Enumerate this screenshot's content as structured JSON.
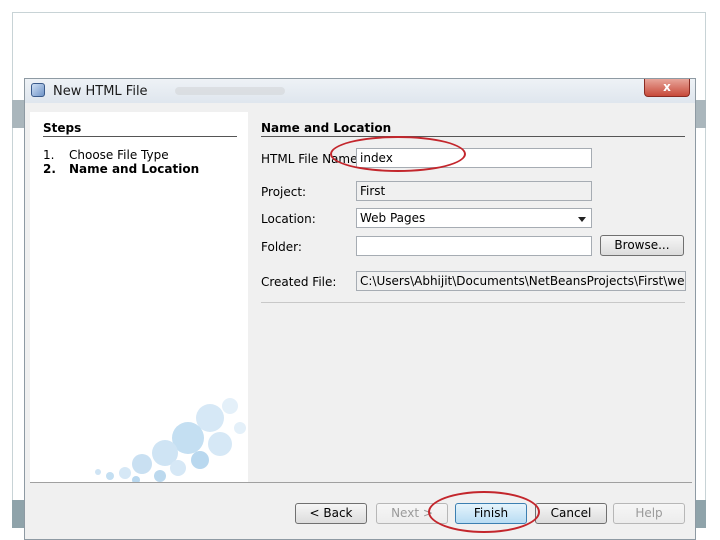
{
  "dialog": {
    "title": "New HTML File",
    "close_symbol": "x"
  },
  "steps": {
    "heading": "Steps",
    "items": [
      {
        "number": "1.",
        "label": "Choose File Type"
      },
      {
        "number": "2.",
        "label": "Name and Location"
      }
    ]
  },
  "form": {
    "section_title": "Name and Location",
    "file_name_label": "HTML File Name:",
    "file_name_value": "index",
    "project_label": "Project:",
    "project_value": "First",
    "location_label": "Location:",
    "location_value": "Web Pages",
    "folder_label": "Folder:",
    "folder_value": "",
    "browse_label": "Browse...",
    "created_file_label": "Created File:",
    "created_file_value": "C:\\Users\\Abhijit\\Documents\\NetBeansProjects\\First\\web\\index.html"
  },
  "buttons": {
    "back": "< Back",
    "next": "Next >",
    "finish": "Finish",
    "cancel": "Cancel",
    "help": "Help"
  },
  "icons": [
    "netbeans-file-icon",
    "close-icon",
    "dropdown-arrow-icon"
  ],
  "colors": {
    "annotation": "#c3262c",
    "close_button": "#c74a3a"
  }
}
